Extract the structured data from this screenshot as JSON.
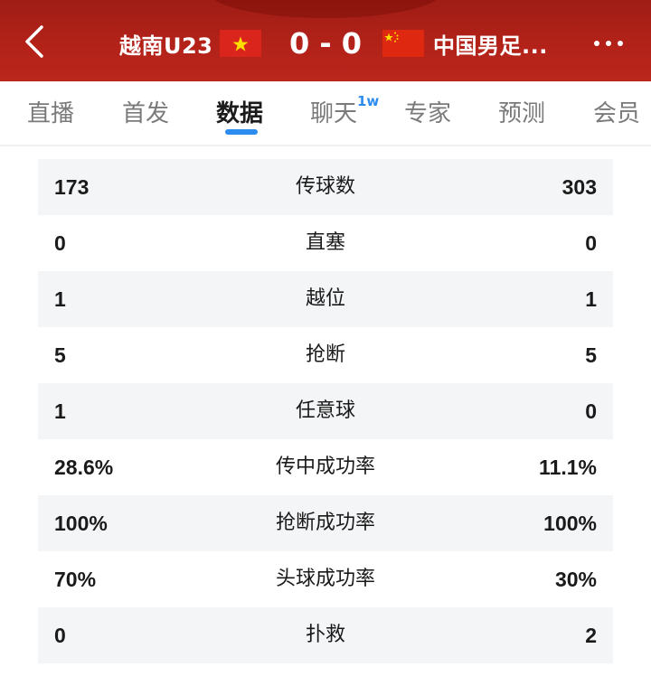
{
  "header": {
    "home_team": "越南U23",
    "home_flag": "vietnam-flag",
    "score": "0 - 0",
    "away_team": "中国男足...",
    "away_flag": "china-flag",
    "colors": {
      "background": "#b32219",
      "text": "#ffffff"
    }
  },
  "tabs": [
    {
      "label": "直播"
    },
    {
      "label": "首发"
    },
    {
      "label": "数据",
      "active": true
    },
    {
      "label": "聊天",
      "badge": "1w"
    },
    {
      "label": "专家"
    },
    {
      "label": "预测"
    },
    {
      "label": "会员"
    }
  ],
  "accent_color": "#2d8cf0",
  "stats": [
    {
      "home": "173",
      "label": "传球数",
      "away": "303"
    },
    {
      "home": "0",
      "label": "直塞",
      "away": "0"
    },
    {
      "home": "1",
      "label": "越位",
      "away": "1"
    },
    {
      "home": "5",
      "label": "抢断",
      "away": "5"
    },
    {
      "home": "1",
      "label": "任意球",
      "away": "0"
    },
    {
      "home": "28.6%",
      "label": "传中成功率",
      "away": "11.1%"
    },
    {
      "home": "100%",
      "label": "抢断成功率",
      "away": "100%"
    },
    {
      "home": "70%",
      "label": "头球成功率",
      "away": "30%"
    },
    {
      "home": "0",
      "label": "扑救",
      "away": "2"
    }
  ]
}
